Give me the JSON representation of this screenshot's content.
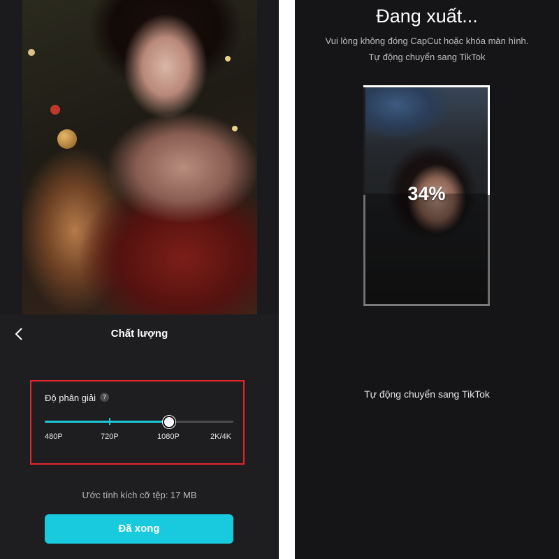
{
  "left_screen": {
    "title": "Chất lượng",
    "back_icon": "chevron-left-icon",
    "resolution": {
      "label": "Độ phân giải",
      "help_icon": "question-icon",
      "help_glyph": "?",
      "options": [
        "480P",
        "720P",
        "1080P",
        "2K/4K"
      ],
      "selected": "1080P",
      "selected_fraction": 0.66
    },
    "size_estimate": "Ước tính kích cỡ tệp: 17 MB",
    "done_label": "Đã xong",
    "colors": {
      "accent": "#19c9dd",
      "highlight_box": "#e0262a"
    }
  },
  "right_screen": {
    "title": "Đang xuất...",
    "warning": "Vui lòng không đóng CapCut hoặc khóa màn hình.",
    "auto_switch_top": "Tự động chuyển sang TikTok",
    "progress_text": "34%",
    "progress_value": 0.34,
    "auto_switch_bottom": "Tự động chuyển sang TikTok"
  }
}
